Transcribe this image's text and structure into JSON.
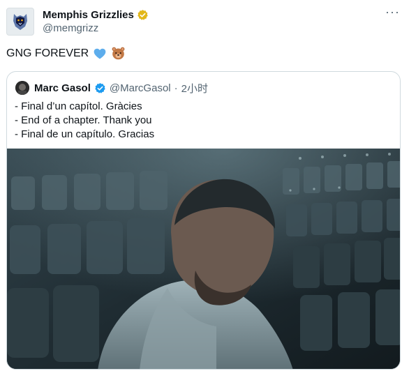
{
  "author": {
    "display_name": "Memphis Grizzlies",
    "handle": "@memgrizz",
    "avatar_icon": "grizzlies-logo-icon",
    "verified_icon": "gold-verified-badge-icon"
  },
  "tweet": {
    "text": "GNG FOREVER",
    "emojis": [
      "blue-heart-icon",
      "bear-face-icon"
    ]
  },
  "quoted_tweet": {
    "display_name": "Marc Gasol",
    "handle": "@MarcGasol",
    "separator": "·",
    "timestamp": "2小时",
    "verified_icon": "blue-verified-badge-icon",
    "lines": [
      "- Final d’un capítol. Gràcies",
      "- End of a chapter. Thank you",
      "- Final de un capítulo. Gracias"
    ]
  },
  "colors": {
    "text_primary": "#0f1419",
    "text_secondary": "#536471",
    "gold_badge": "#e2b719",
    "blue_badge": "#1d9bf0",
    "card_border": "#cfd9de"
  }
}
